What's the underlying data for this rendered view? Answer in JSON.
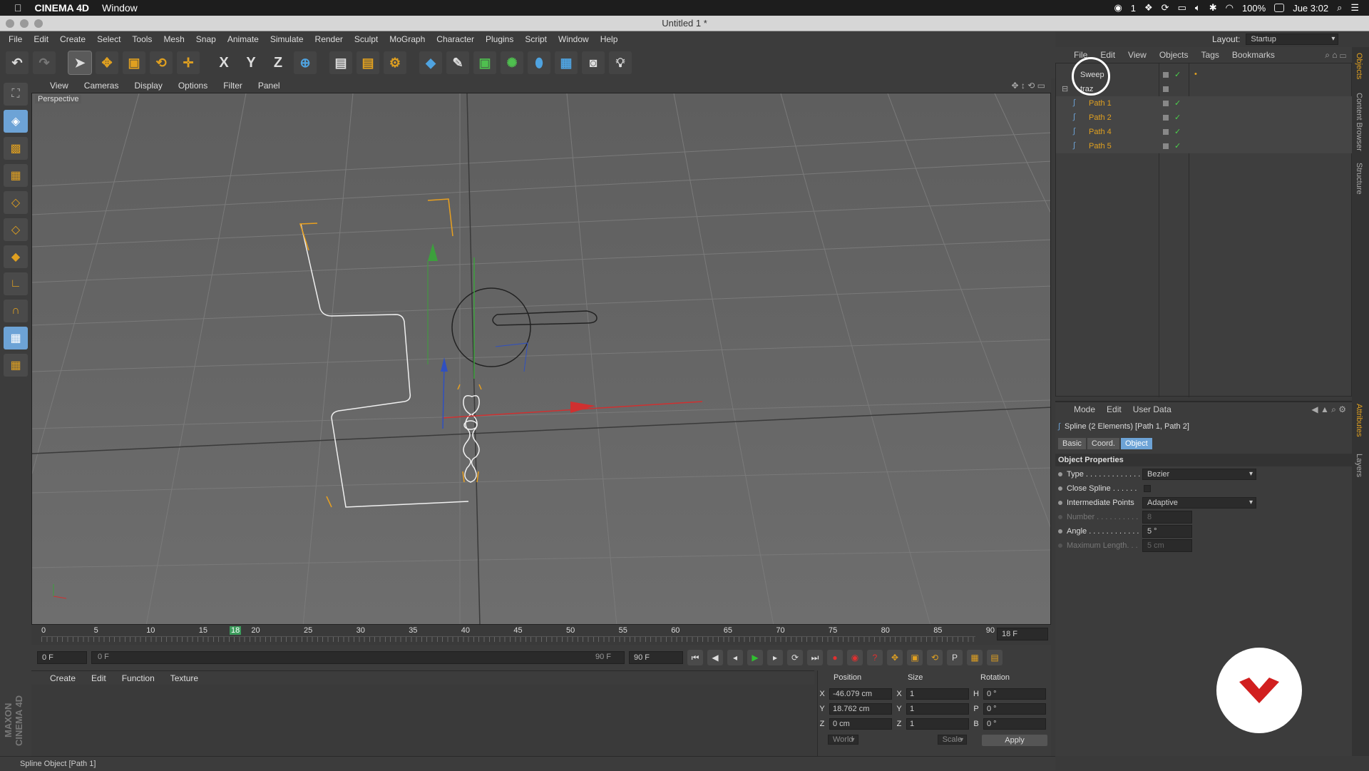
{
  "macbar": {
    "app": "CINEMA 4D",
    "menu": "Window",
    "status_num": "1",
    "battery": "100%",
    "time": "Jue 3:02"
  },
  "window": {
    "title": "Untitled 1 *"
  },
  "app_menu": [
    "File",
    "Edit",
    "Create",
    "Select",
    "Tools",
    "Mesh",
    "Snap",
    "Animate",
    "Simulate",
    "Render",
    "Sculpt",
    "MoGraph",
    "Character",
    "Plugins",
    "Script",
    "Window",
    "Help"
  ],
  "layout": {
    "label": "Layout:",
    "value": "Startup"
  },
  "toolbar": {
    "axis_x": "X",
    "axis_y": "Y",
    "axis_z": "Z"
  },
  "viewport": {
    "menu": [
      "View",
      "Cameras",
      "Display",
      "Options",
      "Filter",
      "Panel"
    ],
    "label": "Perspective"
  },
  "timeline": {
    "ticks": [
      "0",
      "5",
      "10",
      "15",
      "20",
      "25",
      "30",
      "35",
      "40",
      "45",
      "50",
      "55",
      "60",
      "65",
      "70",
      "75",
      "80",
      "85",
      "90"
    ],
    "current_marker": "18",
    "current_frame": "18 F"
  },
  "playbar": {
    "start": "0 F",
    "range_start": "0 F",
    "range_end": "90 F",
    "end": "90 F"
  },
  "material_menu": [
    "Create",
    "Edit",
    "Function",
    "Texture"
  ],
  "maxon": "MAXON CINEMA 4D",
  "coords": {
    "headers": [
      "Position",
      "Size",
      "Rotation"
    ],
    "rows": [
      {
        "axis": "X",
        "pos": "-46.079 cm",
        "size_axis": "X",
        "size": "1",
        "rot_axis": "H",
        "rot": "0 °"
      },
      {
        "axis": "Y",
        "pos": "18.762 cm",
        "size_axis": "Y",
        "size": "1",
        "rot_axis": "P",
        "rot": "0 °"
      },
      {
        "axis": "Z",
        "pos": "0 cm",
        "size_axis": "Z",
        "size": "1",
        "rot_axis": "B",
        "rot": "0 °"
      }
    ],
    "mode1": "World",
    "mode2": "Scale",
    "apply": "Apply"
  },
  "status": "Spline Object [Path 1]",
  "object_manager": {
    "menu": [
      "File",
      "Edit",
      "View",
      "Objects",
      "Tags",
      "Bookmarks"
    ],
    "objects": [
      {
        "name": "Sweep"
      },
      {
        "name": "traz"
      },
      {
        "name": "Path 1"
      },
      {
        "name": "Path 2"
      },
      {
        "name": "Path 4"
      },
      {
        "name": "Path 5"
      }
    ]
  },
  "attributes": {
    "menu": [
      "Mode",
      "Edit",
      "User Data"
    ],
    "title": "Spline (2 Elements) [Path 1, Path 2]",
    "tabs": [
      "Basic",
      "Coord.",
      "Object"
    ],
    "section": "Object Properties",
    "props": [
      {
        "label": "Type . . . . . . . . . . . . .",
        "value": "Bezier"
      },
      {
        "label": "Close Spline . . . . . .",
        "value": ""
      },
      {
        "label": "Intermediate Points",
        "value": "Adaptive"
      },
      {
        "label": "Number . . . . . . . . . .",
        "value": "8"
      },
      {
        "label": "Angle . . . . . . . . . . . .",
        "value": "5 °"
      },
      {
        "label": "Maximum Length. . .",
        "value": "5 cm"
      }
    ]
  },
  "side_tabs": [
    "Objects",
    "Content Browser",
    "Structure",
    "Attributes",
    "Layers"
  ]
}
